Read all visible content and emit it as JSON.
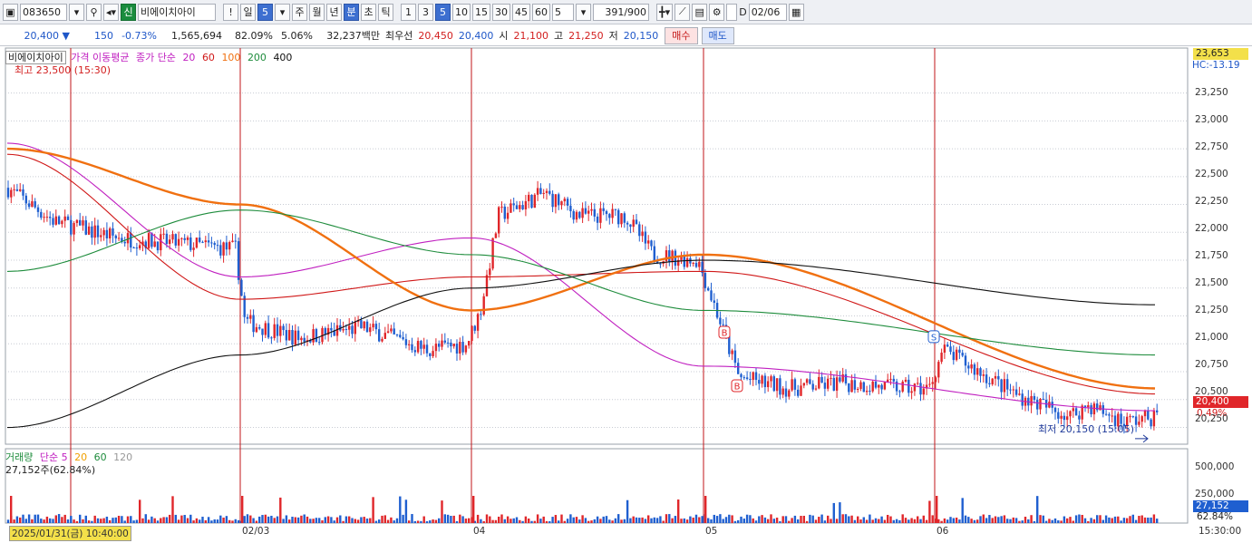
{
  "toolbar": {
    "code": "083650",
    "credit_badge": "신",
    "stock_name": "비에이치아이",
    "alert": "!",
    "period_day": "일",
    "period_day_value": "5",
    "period_week": "주",
    "period_month": "월",
    "period_year": "년",
    "period_minute": "분",
    "period_second": "초",
    "period_tick": "틱",
    "intervals": [
      "1",
      "3",
      "5",
      "10",
      "15",
      "30",
      "45",
      "60"
    ],
    "interval_custom": "5",
    "count": "391",
    "count_total": "/900",
    "date_checkbox_label": "D",
    "date": "02/06"
  },
  "quote": {
    "price": "20,400",
    "change": "150",
    "change_rate": "-0.73%",
    "volume": "1,565,694",
    "volume_rate": "82.09%",
    "turnover_rate": "5.06%",
    "trade_value": "32,237백만",
    "best_label": "최우선",
    "best_ask": "20,450",
    "best_bid": "20,400",
    "open_label": "시",
    "open": "21,100",
    "high_label": "고",
    "high": "21,250",
    "low_label": "저",
    "low": "20,150",
    "buy_button": "매수",
    "sell_button": "매도"
  },
  "chart": {
    "legend_name": "비에이치아이",
    "legend_price": "가격 이동평균",
    "legend_ma_settings": "종가 단순",
    "ma_periods": [
      "20",
      "60",
      "100",
      "200",
      "400"
    ],
    "ma_colors": [
      "#c020c0",
      "#d01818",
      "#f07010",
      "#1e8c3c",
      "#111111"
    ],
    "high_annotation": "최고 23,500 (15:30)",
    "low_annotation": "최저 20,150 (15:05)",
    "top_price_tag": "23,653",
    "top_price_sub": "HC:-13.19",
    "current_price_tag": "20,400",
    "current_change_tag": "0.49%",
    "price_ticks": [
      "23,250",
      "23,000",
      "22,750",
      "22,500",
      "22,250",
      "22,000",
      "21,750",
      "21,500",
      "21,250",
      "21,000",
      "20,750",
      "20,500",
      "20,250"
    ],
    "volume_legend": "거래량",
    "volume_legend_settings": "단순 5",
    "volume_ma_periods": [
      "20",
      "60",
      "120"
    ],
    "volume_ma_colors": [
      "#f0a000",
      "#1e8c3c",
      "#999999"
    ],
    "volume_value": "27,152주(62.84%)",
    "volume_ticks": [
      "500,000",
      "250,000"
    ],
    "volume_tag": "27,152",
    "volume_pct_tag": "62.84%",
    "date_labels": [
      "2025/01/31(금) 10:40:00",
      "02/03",
      "04",
      "05",
      "06"
    ],
    "time_label": "15:30:00",
    "buy_marker": "B",
    "sell_marker": "S"
  },
  "colors": {
    "up": "#e0262a",
    "down": "#1f5fd0",
    "grid": "#c8ccd4",
    "day_line": "#c0141a"
  },
  "chart_data": {
    "type": "candlestick",
    "x": [
      "2025/01/31",
      "02/03",
      "02/04",
      "02/05",
      "02/06"
    ],
    "ylim": [
      20100,
      23653
    ],
    "close_last": 20400,
    "series": [
      {
        "name": "20",
        "values": [
          22800,
          21600,
          21950,
          20800,
          20400
        ]
      },
      {
        "name": "60",
        "values": [
          22700,
          21400,
          21600,
          21650,
          20550
        ]
      },
      {
        "name": "100",
        "values": [
          22750,
          22250,
          21300,
          21800,
          20600
        ]
      },
      {
        "name": "200",
        "values": [
          21650,
          22200,
          21800,
          21300,
          20900
        ]
      },
      {
        "name": "400",
        "values": [
          20250,
          20900,
          21500,
          21750,
          21350
        ]
      }
    ]
  }
}
